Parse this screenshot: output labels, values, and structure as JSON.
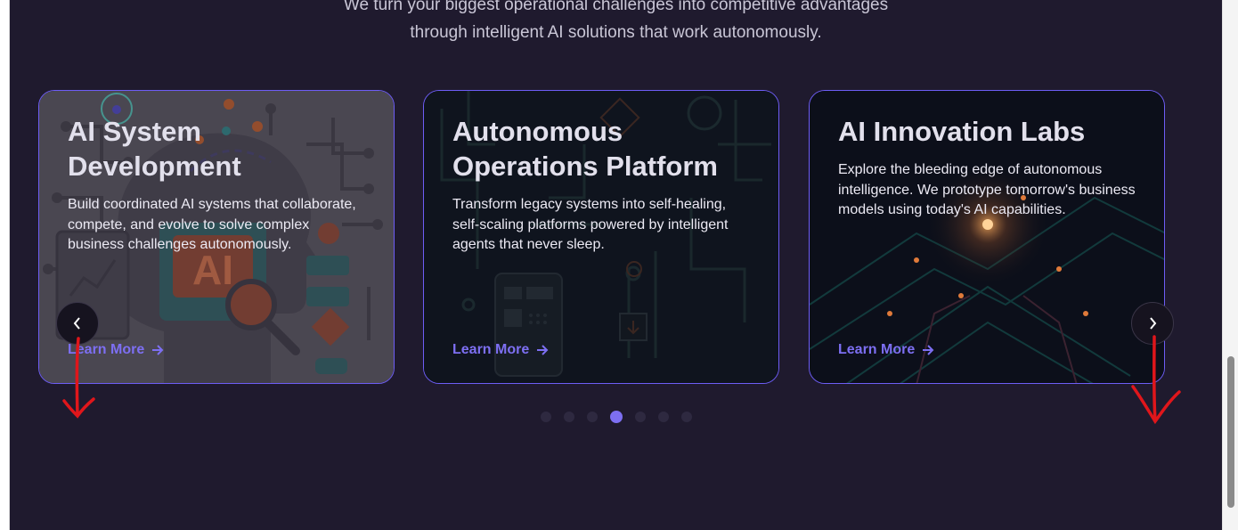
{
  "section": {
    "subtitle_line1": "We turn your biggest operational challenges into competitive advantages",
    "subtitle_line2": "through intelligent AI solutions that work autonomously."
  },
  "cards": [
    {
      "title": "AI System Development",
      "description": "Build coordinated AI systems that collaborate, compete, and evolve to solve complex business challenges autonomously.",
      "cta": "Learn More",
      "art_badge": "AI"
    },
    {
      "title": "Autonomous Operations Platform",
      "description": "Transform legacy systems into self-healing, self-scaling platforms powered by intelligent agents that never sleep.",
      "cta": "Learn More"
    },
    {
      "title": "AI Innovation Labs",
      "description": "Explore the bleeding edge of autonomous intelligence. We prototype tomorrow's business models using today's AI capabilities.",
      "cta": "Learn More"
    }
  ],
  "carousel": {
    "prev_icon": "chevron-left-icon",
    "next_icon": "chevron-right-icon",
    "dot_count": 7,
    "active_dot": 4
  },
  "colors": {
    "background": "#1f1a2e",
    "accent": "#7d6ff2",
    "card_border": "#6d5df5",
    "annotation": "#e0161b"
  }
}
